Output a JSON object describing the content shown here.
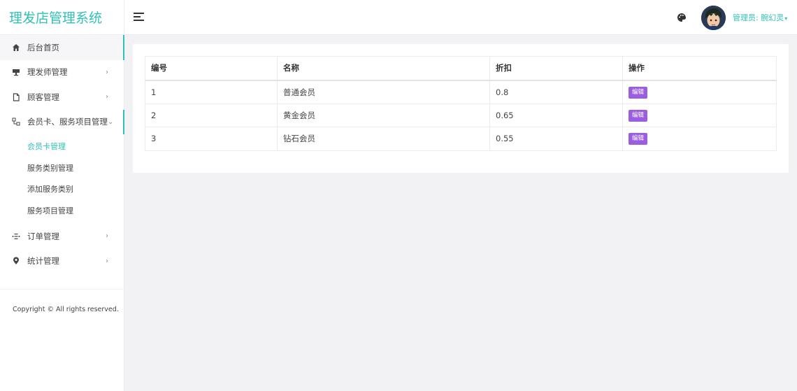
{
  "app": {
    "title": "理发店管理系统"
  },
  "sidebar": {
    "items": [
      {
        "label": "后台首页",
        "icon": "home-icon"
      },
      {
        "label": "理发师管理",
        "icon": "barber-icon"
      },
      {
        "label": "顾客管理",
        "icon": "file-icon"
      },
      {
        "label": "会员卡、服务项目管理",
        "icon": "hierarchy-icon"
      },
      {
        "label": "订单管理",
        "icon": "orders-icon"
      },
      {
        "label": "统计管理",
        "icon": "location-pin-icon"
      }
    ],
    "chevron_right": "›",
    "chevron_down": "⌄",
    "submenu": [
      {
        "label": "会员卡管理"
      },
      {
        "label": "服务类别管理"
      },
      {
        "label": "添加服务类别"
      },
      {
        "label": "服务项目管理"
      }
    ],
    "copyright": "Copyright © All rights reserved."
  },
  "header": {
    "admin_label": "管理员: 腕幻灵",
    "caret": "▾"
  },
  "table": {
    "columns": [
      "编号",
      "名称",
      "折扣",
      "操作"
    ],
    "rows": [
      {
        "id": "1",
        "name": "普通会员",
        "discount": "0.8",
        "action": "编辑"
      },
      {
        "id": "2",
        "name": "黄金会员",
        "discount": "0.65",
        "action": "编辑"
      },
      {
        "id": "3",
        "name": "钻石会员",
        "discount": "0.55",
        "action": "编辑"
      }
    ]
  },
  "colors": {
    "accent": "#2fc1b6",
    "edit_button": "#9b5ee0"
  }
}
